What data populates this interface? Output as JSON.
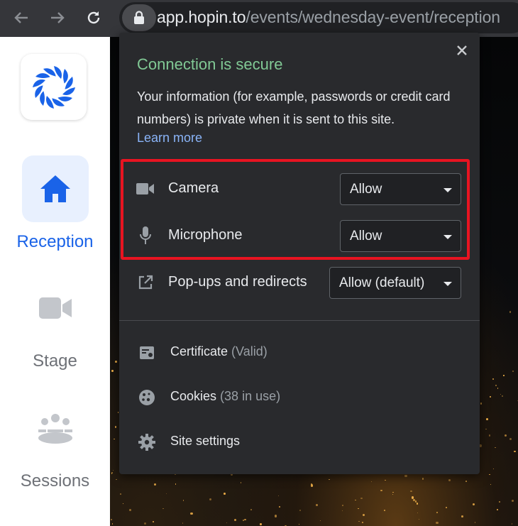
{
  "browser": {
    "url_host": "app.hopin.to",
    "url_path": "/events/wednesday-event/reception",
    "icons": {
      "back": "arrow-left-icon",
      "forward": "arrow-right-icon",
      "reload": "reload-icon",
      "lock": "lock-icon"
    }
  },
  "sidebar": {
    "logo": "hopin-logo",
    "items": [
      {
        "label": "Reception",
        "icon": "home-icon",
        "active": true
      },
      {
        "label": "Stage",
        "icon": "video-camera-icon",
        "active": false
      },
      {
        "label": "Sessions",
        "icon": "people-group-icon",
        "active": false
      }
    ]
  },
  "popup": {
    "title": "Connection is secure",
    "description": "Your information (for example, passwords or credit card numbers) is private when it is sent to this site.",
    "learn_more": "Learn more",
    "permissions": [
      {
        "label": "Camera",
        "value": "Allow",
        "icon": "camera-icon"
      },
      {
        "label": "Microphone",
        "value": "Allow",
        "icon": "microphone-icon"
      },
      {
        "label": "Pop-ups and redirects",
        "value": "Allow (default)",
        "icon": "external-link-icon"
      }
    ],
    "links": [
      {
        "label": "Certificate",
        "sub": "(Valid)",
        "icon": "certificate-icon"
      },
      {
        "label": "Cookies",
        "sub": "(38 in use)",
        "icon": "cookie-icon"
      },
      {
        "label": "Site settings",
        "sub": "",
        "icon": "gear-icon"
      }
    ]
  },
  "colors": {
    "accent_blue": "#1a63e8",
    "secure_green": "#81c995",
    "link_blue": "#8ab4f8",
    "highlight_red": "#e81421"
  }
}
